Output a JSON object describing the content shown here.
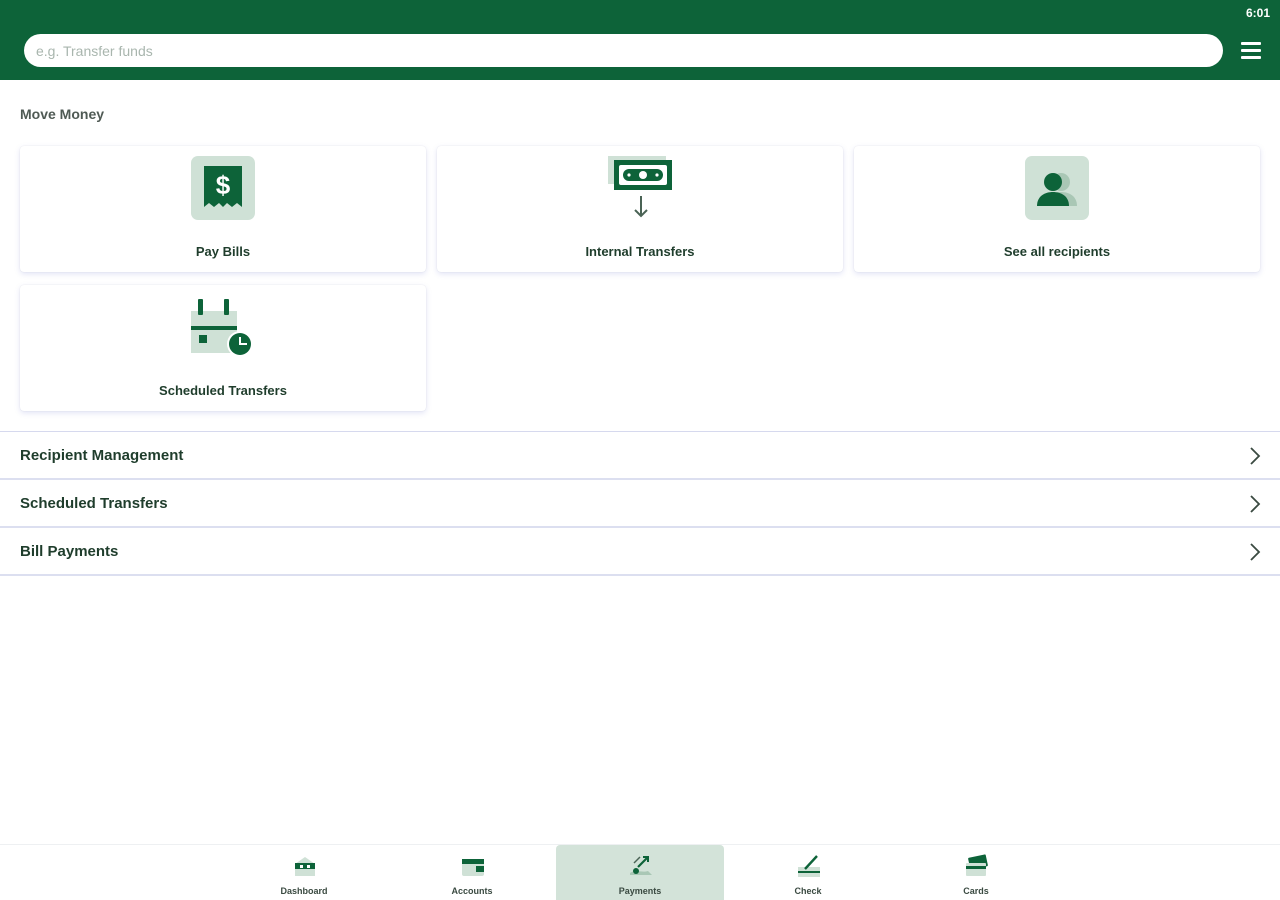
{
  "status_bar": {
    "time": "6:01"
  },
  "header": {
    "search_placeholder": "e.g. Transfer funds",
    "search_icon_name": "search-input",
    "menu_icon": "hamburger-menu-icon"
  },
  "move_money": {
    "title": "Move Money",
    "tiles": [
      {
        "label": "Pay Bills",
        "icon": "bill-dollar-icon"
      },
      {
        "label": "Internal Transfers",
        "icon": "money-transfer-icon"
      },
      {
        "label": "See all recipients",
        "icon": "recipients-icon"
      },
      {
        "label": "Scheduled Transfers",
        "icon": "calendar-clock-icon"
      }
    ]
  },
  "list_rows": [
    {
      "label": "Recipient Management",
      "icon": "chevron-right-icon"
    },
    {
      "label": "Scheduled Transfers",
      "icon": "chevron-right-icon"
    },
    {
      "label": "Bill Payments",
      "icon": "chevron-right-icon"
    }
  ],
  "bottom_nav": {
    "items": [
      {
        "label": "Dashboard",
        "icon": "dashboard-home-icon"
      },
      {
        "label": "Accounts",
        "icon": "wallet-icon"
      },
      {
        "label": "Payments",
        "icon": "payments-icon",
        "active": true
      },
      {
        "label": "Check",
        "icon": "check-deposit-icon"
      },
      {
        "label": "Cards",
        "icon": "cards-icon"
      }
    ]
  },
  "colors": {
    "brand_green": "#0d6339",
    "icon_tint": "#cfe1d6",
    "active_tab": "#d3e3d9",
    "text_dark": "#1f3d2c"
  }
}
